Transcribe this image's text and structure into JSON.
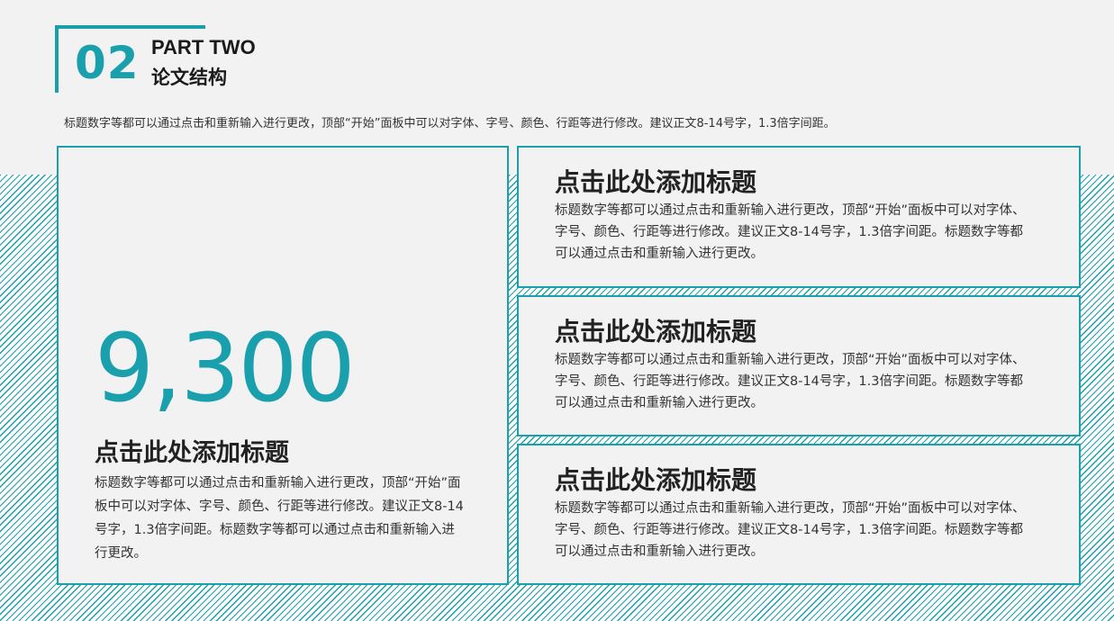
{
  "header": {
    "number": "02",
    "part_label": "PART TWO",
    "title": "论文结构"
  },
  "intro_text": "标题数字等都可以通过点击和重新输入进行更改，顶部“开始”面板中可以对字体、字号、颜色、行距等进行修改。建议正文8-14号字，1.3倍字间距。",
  "feature_card": {
    "number": "9,300",
    "title": "点击此处添加标题",
    "body": "标题数字等都可以通过点击和重新输入进行更改，顶部“开始”面板中可以对字体、字号、颜色、行距等进行修改。建议正文8-14号字，1.3倍字间距。标题数字等都可以通过点击和重新输入进行更改。"
  },
  "cards": [
    {
      "title": "点击此处添加标题",
      "body": "标题数字等都可以通过点击和重新输入进行更改，顶部“开始”面板中可以对字体、字号、颜色、行距等进行修改。建议正文8-14号字，1.3倍字间距。标题数字等都可以通过点击和重新输入进行更改。"
    },
    {
      "title": "点击此处添加标题",
      "body": "标题数字等都可以通过点击和重新输入进行更改，顶部“开始”面板中可以对字体、字号、颜色、行距等进行修改。建议正文8-14号字，1.3倍字间距。标题数字等都可以通过点击和重新输入进行更改。"
    },
    {
      "title": "点击此处添加标题",
      "body": "标题数字等都可以通过点击和重新输入进行更改，顶部“开始”面板中可以对字体、字号、颜色、行距等进行修改。建议正文8-14号字，1.3倍字间距。标题数字等都可以通过点击和重新输入进行更改。"
    }
  ],
  "colors": {
    "accent": "#1a9fad",
    "background": "#f2f2f2",
    "text": "#333333",
    "heading": "#222222"
  }
}
